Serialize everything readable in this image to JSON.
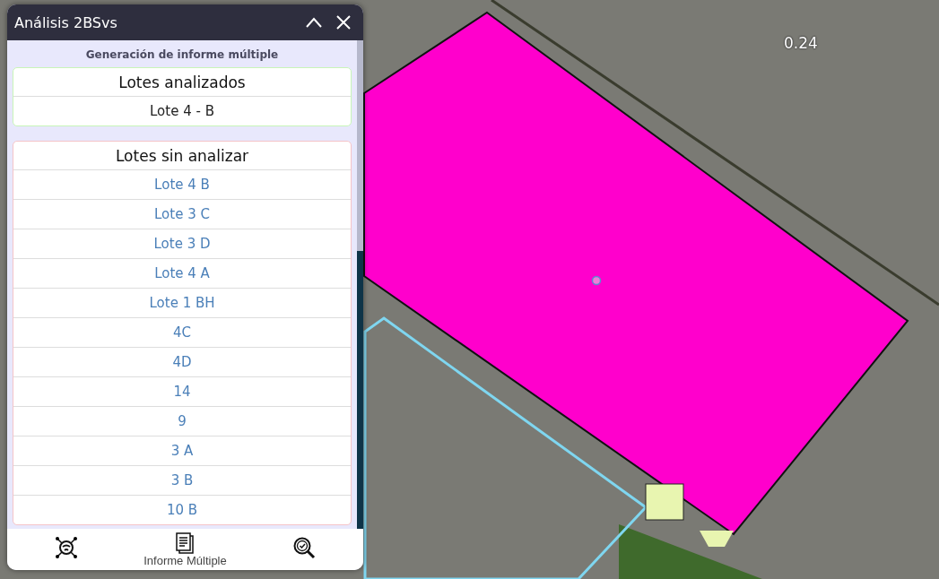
{
  "map": {
    "labels": [
      "0.24"
    ]
  },
  "window": {
    "title": "Análisis 2BSvs",
    "subtitle": "Generación de informe múltiple"
  },
  "analyzed": {
    "title": "Lotes analizados",
    "items": [
      "Lote 4 - B"
    ]
  },
  "unanalyzed": {
    "title": "Lotes sin analizar",
    "items": [
      "Lote 4 B",
      "Lote 3 C",
      "Lote 3 D",
      "Lote 4 A",
      "Lote 1 BH",
      "4C",
      "4D",
      "14",
      "9",
      "3 A",
      "3 B",
      "10 B"
    ]
  },
  "footer_tabs": [
    {
      "kind": "network",
      "selected": false
    },
    {
      "kind": "report",
      "label": "Informe Múltiple",
      "selected": true
    },
    {
      "kind": "search",
      "selected": false
    }
  ]
}
